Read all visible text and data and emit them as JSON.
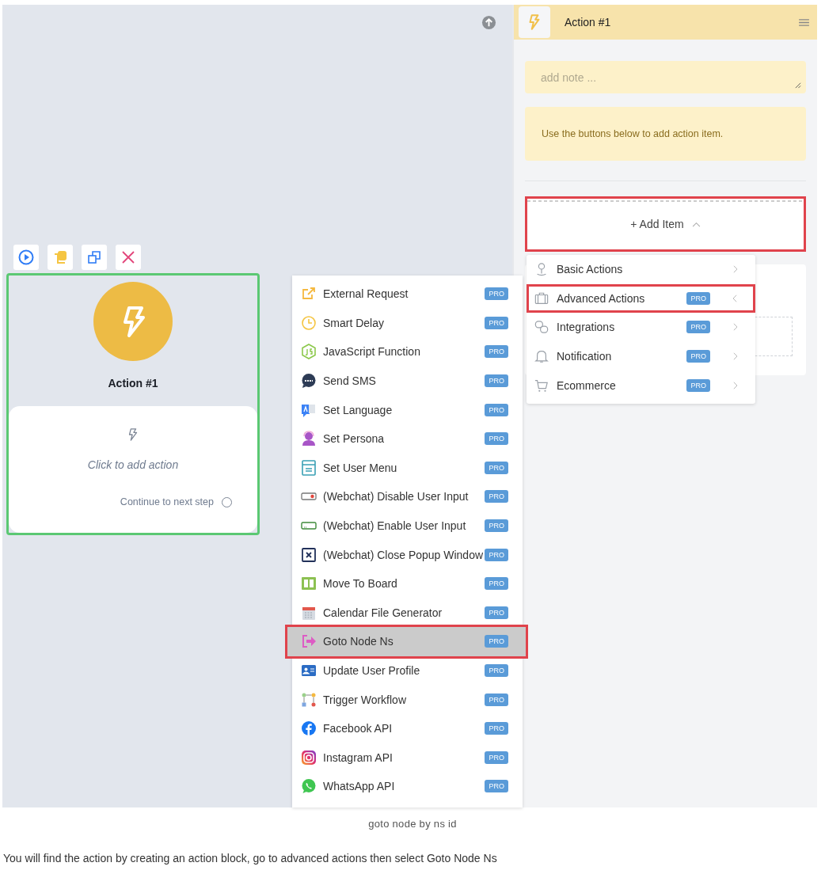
{
  "canvas": {
    "node": {
      "title": "Action #1",
      "placeholder_action": "Click to add action",
      "continue_label": "Continue to next step",
      "selected": true
    },
    "node_tools": [
      {
        "kind": "play"
      },
      {
        "kind": "copy"
      },
      {
        "kind": "duplicate"
      },
      {
        "kind": "delete"
      }
    ]
  },
  "panel": {
    "title": "Action #1",
    "note": {
      "placeholder": "add note ..."
    },
    "info": "Use the buttons below to add action item.",
    "add_item": {
      "label": "+ Add Item",
      "expanded": true,
      "outlined": true
    },
    "categories": [
      {
        "label": "Basic Actions",
        "kind": "person",
        "pro": false,
        "selected": false,
        "outlined": false
      },
      {
        "label": "Advanced Actions",
        "kind": "briefcase",
        "pro": true,
        "badge": "PRO",
        "selected": true,
        "outlined": true
      },
      {
        "label": "Integrations",
        "kind": "link",
        "pro": true,
        "badge": "PRO",
        "selected": false,
        "outlined": false
      },
      {
        "label": "Notification",
        "kind": "bell",
        "pro": true,
        "badge": "PRO",
        "selected": false,
        "outlined": false
      },
      {
        "label": "Ecommerce",
        "kind": "cart",
        "pro": true,
        "badge": "PRO",
        "selected": false,
        "outlined": false
      }
    ]
  },
  "submenu": [
    {
      "label": "External Request",
      "kind": "external",
      "badge": "PRO",
      "selected": false
    },
    {
      "label": "Smart Delay",
      "kind": "clock",
      "badge": "PRO",
      "selected": false
    },
    {
      "label": "JavaScript Function",
      "kind": "js",
      "badge": "PRO",
      "selected": false
    },
    {
      "label": "Send SMS",
      "kind": "sms",
      "badge": "PRO",
      "selected": false
    },
    {
      "label": "Set Language",
      "kind": "language",
      "badge": "PRO",
      "selected": false
    },
    {
      "label": "Set Persona",
      "kind": "persona",
      "badge": "PRO",
      "selected": false
    },
    {
      "label": "Set User Menu",
      "kind": "menu",
      "badge": "PRO",
      "selected": false
    },
    {
      "label": "(Webchat) Disable User Input",
      "kind": "disable",
      "badge": "PRO",
      "selected": false
    },
    {
      "label": "(Webchat) Enable User Input",
      "kind": "enable",
      "badge": "PRO",
      "selected": false
    },
    {
      "label": "(Webchat) Close Popup Window",
      "kind": "close",
      "badge": "PRO",
      "selected": false
    },
    {
      "label": "Move To Board",
      "kind": "board",
      "badge": "PRO",
      "selected": false
    },
    {
      "label": "Calendar File Generator",
      "kind": "calendar",
      "badge": "PRO",
      "selected": false
    },
    {
      "label": "Goto Node Ns",
      "kind": "goto",
      "badge": "PRO",
      "selected": true
    },
    {
      "label": "Update User Profile",
      "kind": "profile",
      "badge": "PRO",
      "selected": false
    },
    {
      "label": "Trigger Workflow",
      "kind": "workflow",
      "badge": "PRO",
      "selected": false
    },
    {
      "label": "Facebook API",
      "kind": "facebook",
      "badge": "PRO",
      "selected": false
    },
    {
      "label": "Instagram API",
      "kind": "instagram",
      "badge": "PRO",
      "selected": false
    },
    {
      "label": "WhatsApp API",
      "kind": "whatsapp",
      "badge": "PRO",
      "selected": false
    }
  ],
  "caption": "goto node by ns id",
  "paragraph": "You will find the action by creating an action block, go to advanced actions then select Goto Node Ns"
}
